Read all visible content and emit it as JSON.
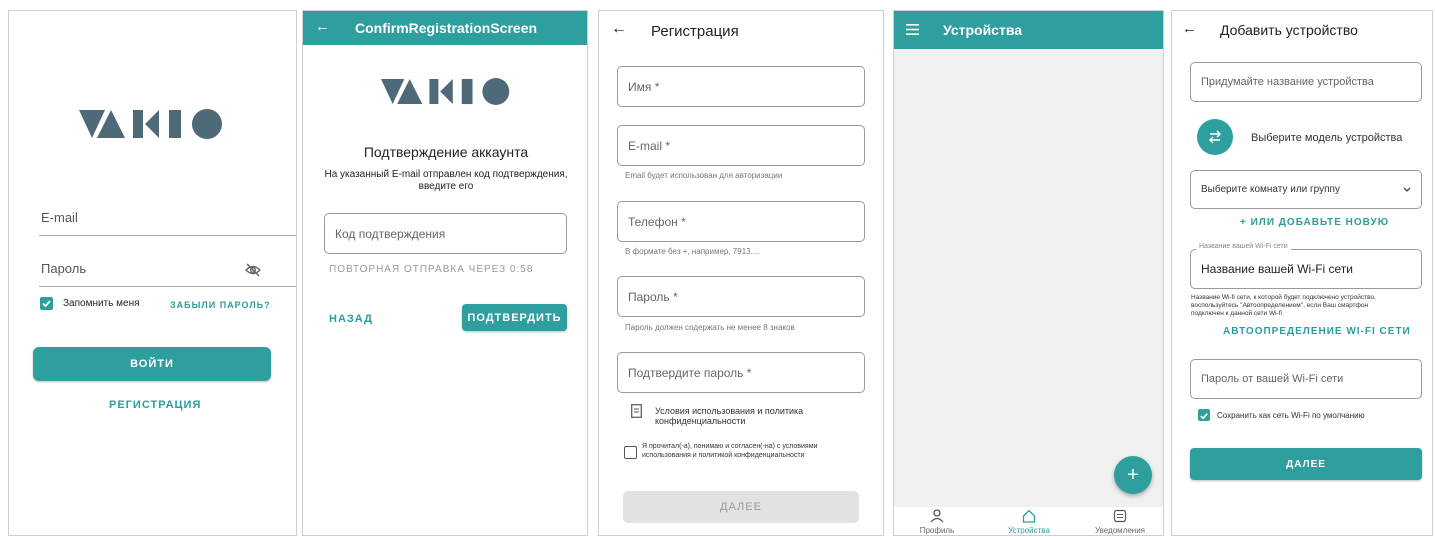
{
  "login": {
    "logo": "VAKIO",
    "email_placeholder": "E-mail",
    "password_placeholder": "Пароль",
    "remember_label": "Запомнить меня",
    "forgot_link": "ЗАБЫЛИ ПАРОЛЬ?",
    "login_button": "ВОЙТИ",
    "register_link": "РЕГИСТРАЦИЯ"
  },
  "confirm": {
    "appbar_title": "ConfirmRegistrationScreen",
    "logo": "VAKIO",
    "heading": "Подтверждение аккаунта",
    "subtext_line1": "На указанный E-mail отправлен код подтверждения,",
    "subtext_line2": "введите его",
    "code_placeholder": "Код подтверждения",
    "resend_text": "ПОВТОРНАЯ ОТПРАВКА ЧЕРЕЗ 0:58",
    "back_button": "НАЗАД",
    "confirm_button": "ПОДТВЕРДИТЬ"
  },
  "register": {
    "title": "Регистрация",
    "name_placeholder": "Имя *",
    "email_placeholder": "E-mail *",
    "email_helper": "Email будет использован для авторизации",
    "phone_placeholder": "Телефон *",
    "phone_helper": "В формате без +, например, 7913....",
    "password_placeholder": "Пароль *",
    "password_helper": "Пароль должен содержать не менее 8 знаков",
    "confirm_password_placeholder": "Подтвердите пароль *",
    "terms_line1": "Условия использования и политика",
    "terms_line2": "конфиденциальности",
    "agree_line1": "Я прочитал(-а), понимаю и согласен(-на) с условиями",
    "agree_line2": "использования и политикой конфиденциальности",
    "next_button": "ДАЛЕЕ"
  },
  "devices": {
    "title": "Устройства",
    "fab": "+",
    "nav": [
      {
        "label": "Профиль",
        "icon": "person-icon"
      },
      {
        "label": "Устройства",
        "icon": "home-icon"
      },
      {
        "label": "Уведомления",
        "icon": "notifications-icon"
      }
    ],
    "active_color": "#2a9d9f"
  },
  "add_device": {
    "title": "Добавить устройство",
    "name_placeholder": "Придумайте название устройства",
    "model_label": "Выберите модель устройства",
    "room_select": "Выберите комнату или группу",
    "add_new_link": "+ ИЛИ ДОБАВЬТЕ НОВУЮ",
    "wifi_label": "Название вашей Wi-Fi сети",
    "wifi_value": "Название вашей Wi-Fi сети",
    "wifi_helper_line1": "Название Wi-fi сети, к которой будет подключено устройство,",
    "wifi_helper_line2": "воспользуйтесь \"Автоопределением\", если Ваш смартфон",
    "wifi_helper_line3": "подключен к данной сети Wi-fi",
    "autodetect_link": "АВТООПРЕДЕЛЕНИЕ WI-FI СЕТИ",
    "wifi_password_placeholder": "Пароль от вашей Wi-Fi сети",
    "save_default_label": "Сохранить как сеть Wi-Fi по умолчанию",
    "next_button": "ДАЛЕЕ"
  },
  "colors": {
    "accent": "#2f9e9f",
    "logo": "#4e6a78"
  }
}
